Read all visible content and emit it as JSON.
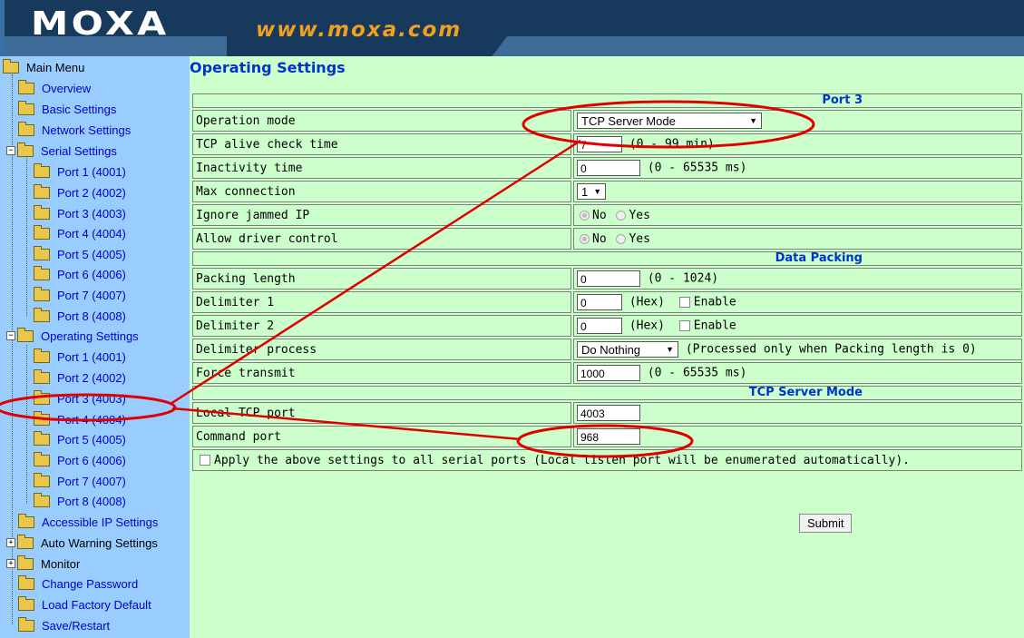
{
  "header": {
    "logo": "MOXA",
    "site": "www.moxa.com"
  },
  "sidebar": {
    "items": [
      {
        "label": "Main Menu"
      },
      {
        "label": "Overview"
      },
      {
        "label": "Basic Settings"
      },
      {
        "label": "Network Settings"
      },
      {
        "label": "Serial Settings"
      },
      {
        "label": "Port 1 (4001)"
      },
      {
        "label": "Port 2 (4002)"
      },
      {
        "label": "Port 3 (4003)"
      },
      {
        "label": "Port 4 (4004)"
      },
      {
        "label": "Port 5 (4005)"
      },
      {
        "label": "Port 6 (4006)"
      },
      {
        "label": "Port 7 (4007)"
      },
      {
        "label": "Port 8 (4008)"
      },
      {
        "label": "Operating Settings"
      },
      {
        "label": "Port 1 (4001)"
      },
      {
        "label": "Port 2 (4002)"
      },
      {
        "label": "Port 3 (4003)"
      },
      {
        "label": "Port 4 (4004)"
      },
      {
        "label": "Port 5 (4005)"
      },
      {
        "label": "Port 6 (4006)"
      },
      {
        "label": "Port 7 (4007)"
      },
      {
        "label": "Port 8 (4008)"
      },
      {
        "label": "Accessible IP Settings"
      },
      {
        "label": "Auto Warning Settings"
      },
      {
        "label": "Monitor"
      },
      {
        "label": "Change Password"
      },
      {
        "label": "Load Factory Default"
      },
      {
        "label": "Save/Restart"
      }
    ],
    "expand_minus": "−",
    "expand_plus": "+"
  },
  "page": {
    "title": "Operating Settings",
    "sections": {
      "port": "Port 3",
      "packing": "Data Packing",
      "mode": "TCP Server Mode"
    },
    "rows": {
      "operation_mode": {
        "label": "Operation mode",
        "value": "TCP Server Mode"
      },
      "tcp_alive": {
        "label": "TCP alive check time",
        "value": "7",
        "hint": "(0 - 99 min)"
      },
      "inactivity": {
        "label": "Inactivity time",
        "value": "0",
        "hint": "(0 - 65535 ms)"
      },
      "max_conn": {
        "label": "Max connection",
        "value": "1"
      },
      "ignore_jammed": {
        "label": "Ignore jammed IP",
        "opt_no": "No",
        "opt_yes": "Yes"
      },
      "allow_driver": {
        "label": "Allow driver control",
        "opt_no": "No",
        "opt_yes": "Yes"
      },
      "packing_length": {
        "label": "Packing length",
        "value": "0",
        "hint": "(0 - 1024)"
      },
      "delim1": {
        "label": "Delimiter 1",
        "value": "0",
        "hint": "(Hex)",
        "check": "Enable"
      },
      "delim2": {
        "label": "Delimiter 2",
        "value": "0",
        "hint": "(Hex)",
        "check": "Enable"
      },
      "delim_process": {
        "label": "Delimiter process",
        "value": "Do Nothing",
        "hint": "(Processed only when Packing length is 0)"
      },
      "force_tx": {
        "label": "Force transmit",
        "value": "1000",
        "hint": "(0 - 65535 ms)"
      },
      "local_port": {
        "label": "Local TCP port",
        "value": "4003"
      },
      "cmd_port": {
        "label": "Command port",
        "value": "968"
      }
    },
    "apply_all": "Apply the above settings to all serial ports (Local listen port will be enumerated automatically).",
    "submit": "Submit"
  },
  "annotation_color": "#e00000",
  "colors": {
    "content_bg": "#ccffcc",
    "sidebar_bg": "#99ccff",
    "header_bg": "#17395c",
    "accent": "#f0a020"
  }
}
